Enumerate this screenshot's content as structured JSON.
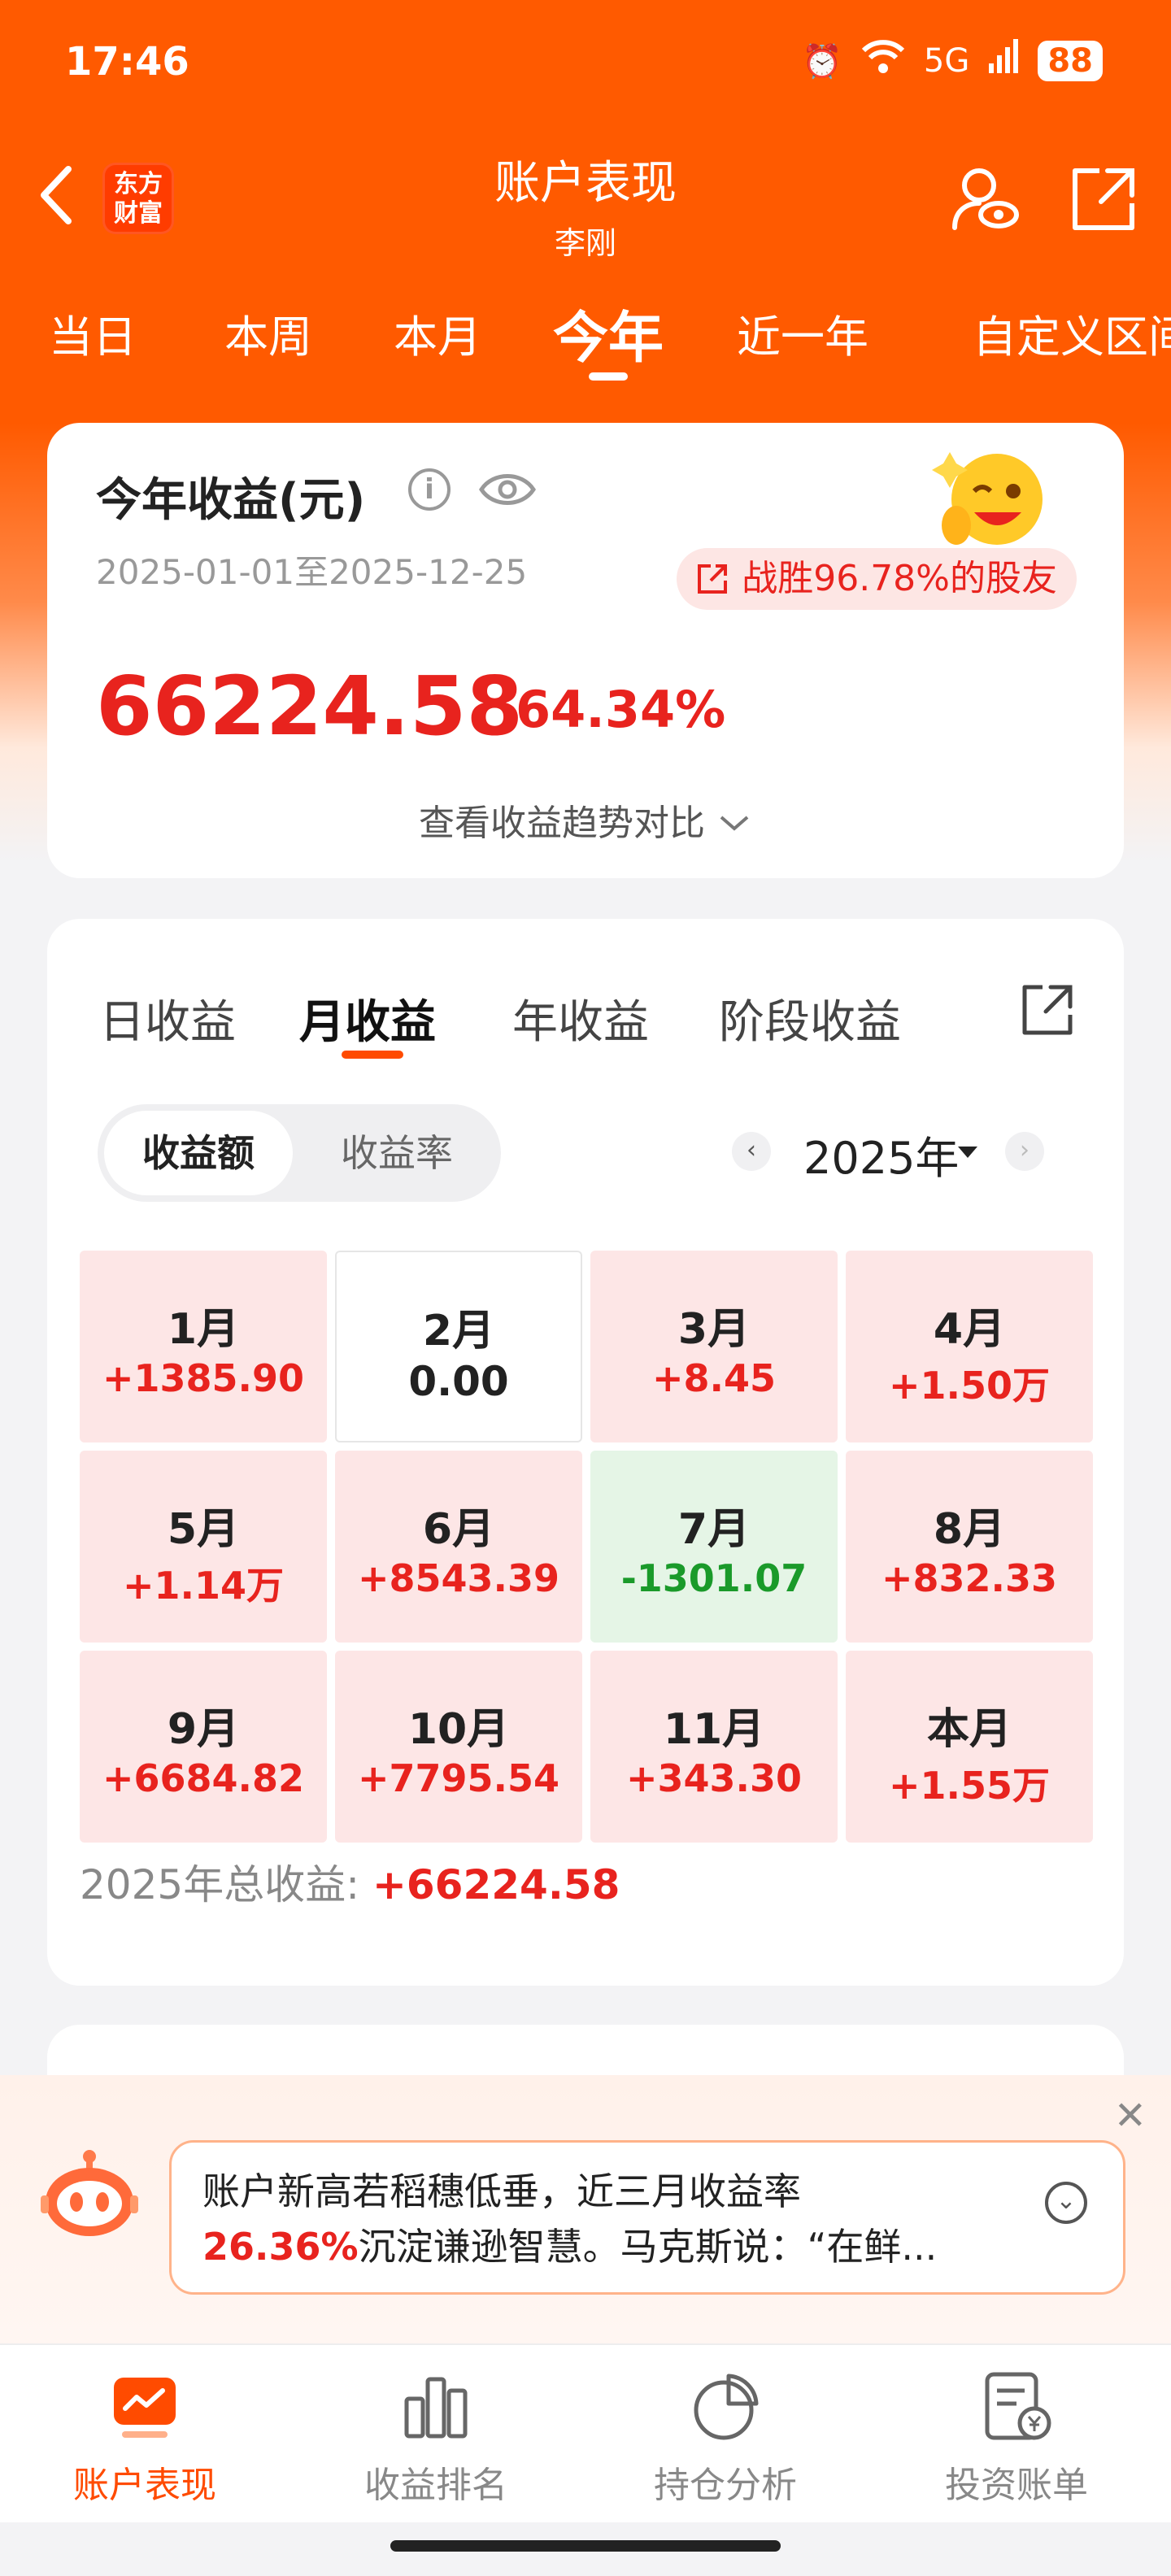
{
  "status_bar": {
    "time": "17:46",
    "network": "5G",
    "battery": "88"
  },
  "header": {
    "title": "账户表现",
    "subtitle": "李刚",
    "logo_top": "东方",
    "logo_bottom": "财富",
    "icons": [
      "back-icon",
      "user-view-icon",
      "share-out-icon"
    ]
  },
  "period_tabs": [
    "当日",
    "本周",
    "本月",
    "今年",
    "近一年",
    "自定义区间"
  ],
  "period_active": "今年",
  "summary": {
    "title": "今年收益(元)",
    "date_range": "2025-01-01至2025-12-25",
    "beat_text": "战胜96.78%的股友",
    "amount": "66224.58",
    "rate": "64.34%",
    "trend_link": "查看收益趋势对比"
  },
  "monthly": {
    "tabs": [
      "日收益",
      "月收益",
      "年收益",
      "阶段收益"
    ],
    "active_tab": "月收益",
    "toggle_on": "收益额",
    "toggle_off": "收益率",
    "year": "2025年",
    "cells": [
      {
        "month": "1月",
        "value": "+1385.90",
        "kind": "pos"
      },
      {
        "month": "2月",
        "value": "0.00",
        "kind": "zero"
      },
      {
        "month": "3月",
        "value": "+8.45",
        "kind": "pos"
      },
      {
        "month": "4月",
        "value": "+1.50万",
        "kind": "pos"
      },
      {
        "month": "5月",
        "value": "+1.14万",
        "kind": "pos"
      },
      {
        "month": "6月",
        "value": "+8543.39",
        "kind": "pos"
      },
      {
        "month": "7月",
        "value": "-1301.07",
        "kind": "neg"
      },
      {
        "month": "8月",
        "value": "+832.33",
        "kind": "pos"
      },
      {
        "month": "9月",
        "value": "+6684.82",
        "kind": "pos"
      },
      {
        "month": "10月",
        "value": "+7795.54",
        "kind": "pos"
      },
      {
        "month": "11月",
        "value": "+343.30",
        "kind": "pos"
      },
      {
        "month": "本月",
        "value": "+1.55万",
        "kind": "pos"
      }
    ],
    "total_label": "2025年总收益:",
    "total_value": "+66224.58"
  },
  "ai_banner": {
    "line1": "账户新高若稻穗低垂，近三月收益率",
    "rate": "26.36%",
    "line2": "沉淀谦逊智慧。马克斯说：“在鲜..."
  },
  "bottom_nav": [
    {
      "label": "账户表现",
      "icon": "chart-icon",
      "active": true
    },
    {
      "label": "收益排名",
      "icon": "bar-chart-icon",
      "active": false
    },
    {
      "label": "持仓分析",
      "icon": "pie-chart-icon",
      "active": false
    },
    {
      "label": "投资账单",
      "icon": "bill-icon",
      "active": false
    }
  ],
  "colors": {
    "brand": "#ff5a00",
    "gain": "#e8231e",
    "loss": "#1a9a2a"
  }
}
